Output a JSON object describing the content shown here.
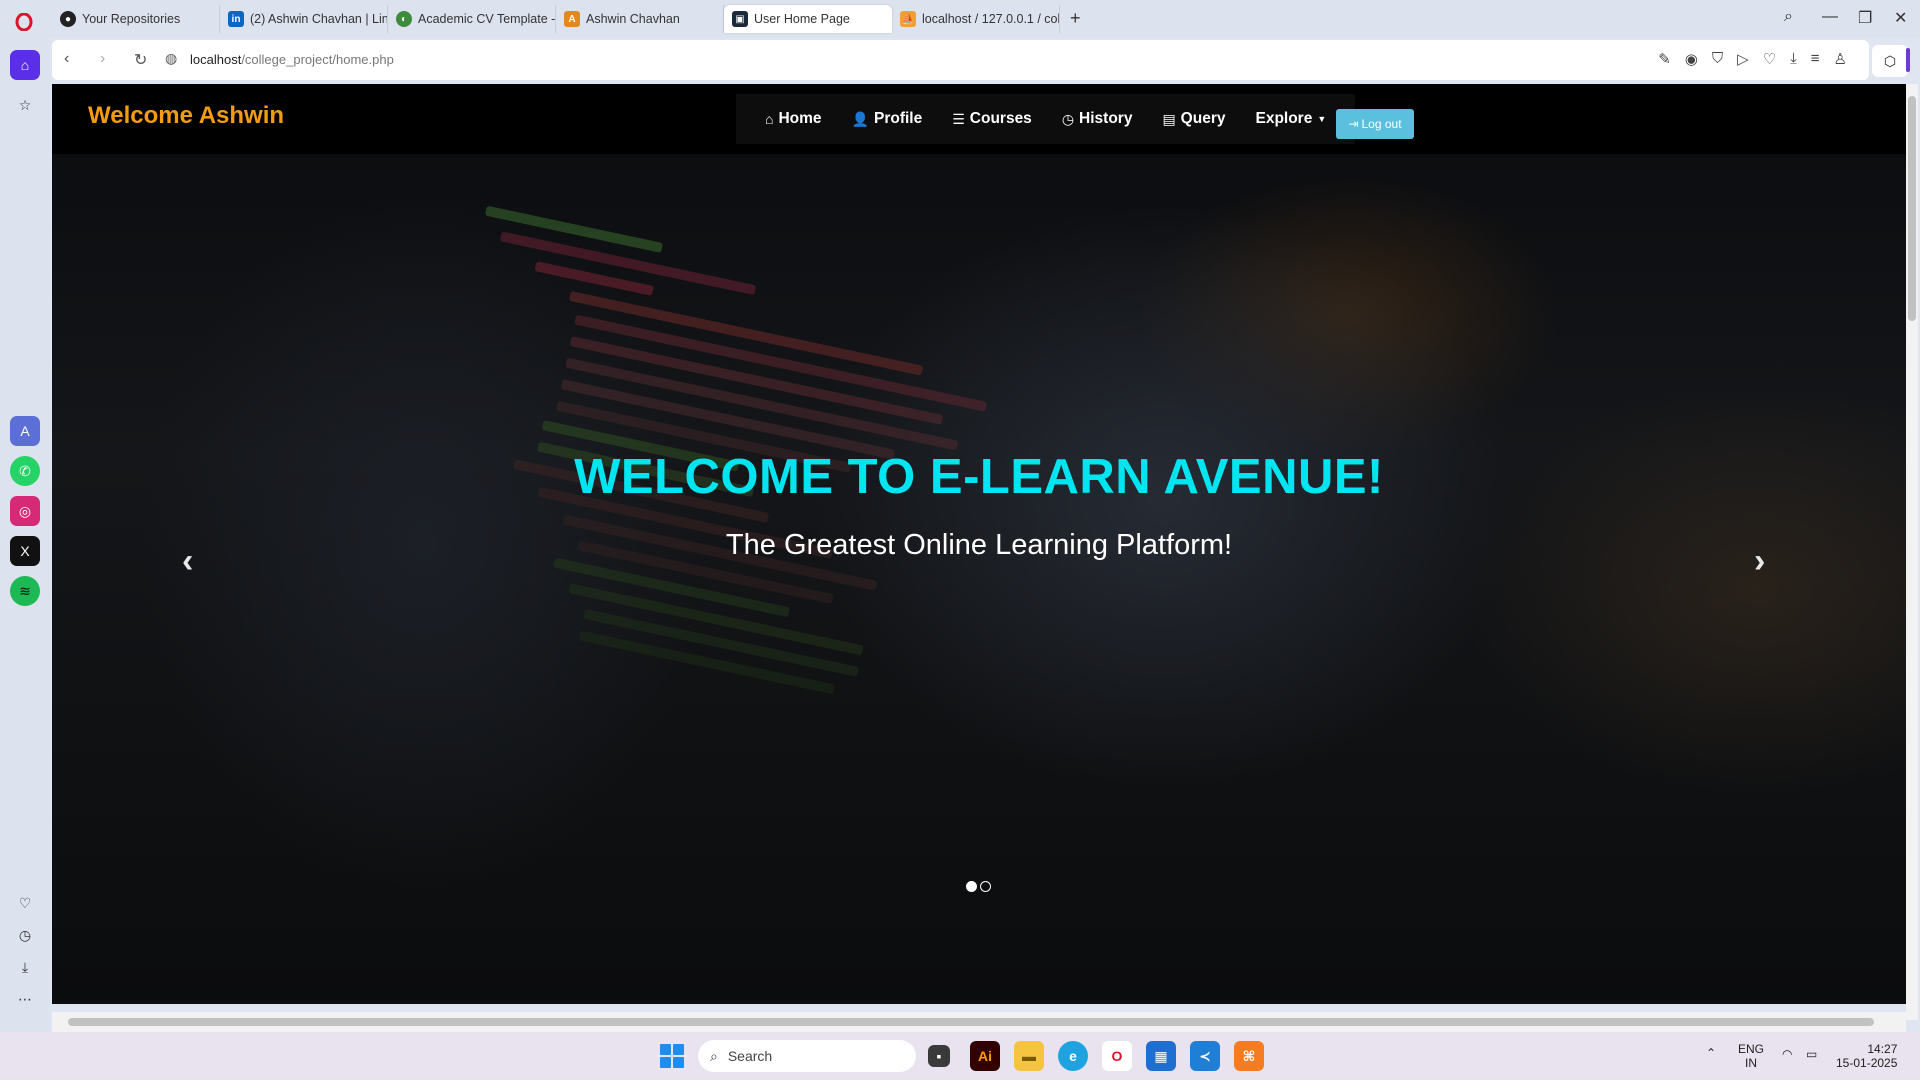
{
  "browser": {
    "tabs": [
      {
        "label": "Your Repositories",
        "icon": "github-icon"
      },
      {
        "label": "(2) Ashwin Chavhan | Linke",
        "icon": "linkedin-icon"
      },
      {
        "label": "Academic CV Template - C",
        "icon": "overleaf-icon"
      },
      {
        "label": "Ashwin Chavhan",
        "icon": "portfolio-icon"
      },
      {
        "label": "User Home Page",
        "icon": "page-icon"
      },
      {
        "label": "localhost / 127.0.0.1 / colle",
        "icon": "phpmyadmin-icon"
      }
    ],
    "url_host": "localhost",
    "url_path": "/college_project/home.php"
  },
  "page": {
    "brand": "Welcome Ashwin",
    "nav": [
      {
        "label": "Home",
        "icon": "home-icon"
      },
      {
        "label": "Profile",
        "icon": "user-icon"
      },
      {
        "label": "Courses",
        "icon": "list-icon"
      },
      {
        "label": "History",
        "icon": "clock-icon"
      },
      {
        "label": "Query",
        "icon": "document-icon"
      },
      {
        "label": "Explore",
        "icon": "caret-down-icon"
      }
    ],
    "logout_label": "Log out",
    "hero_title": "WELCOME TO E-LEARN AVENUE!",
    "hero_subtitle": "The Greatest Online Learning Platform!",
    "carousel_slide": 1,
    "carousel_total": 2
  },
  "taskbar": {
    "search_placeholder": "Search",
    "lang": "ENG",
    "region": "IN",
    "time": "14:27",
    "date": "15-01-2025"
  },
  "colors": {
    "brand": "#f39c12",
    "hero_title": "#00e5f0",
    "logout_button": "#5bc0de",
    "opera_red": "#e0112b"
  }
}
